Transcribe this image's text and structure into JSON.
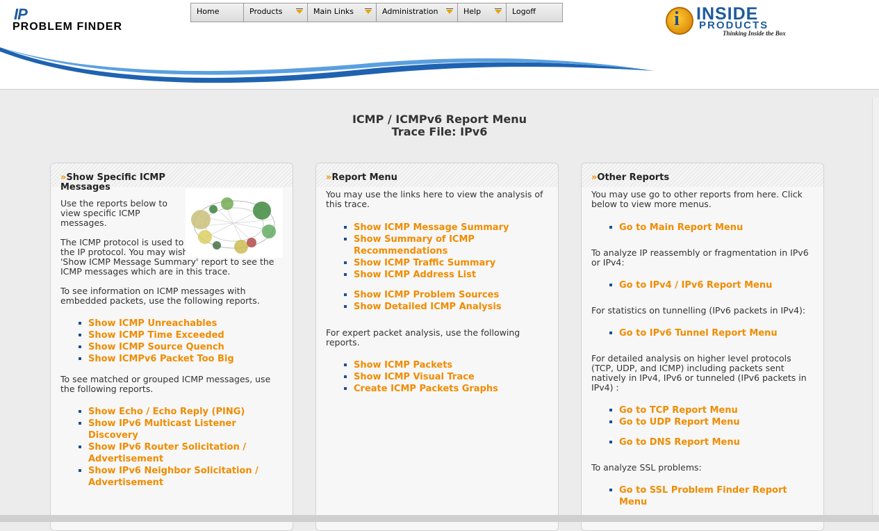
{
  "logo": {
    "ip": "IP",
    "name": "PROBLEM FINDER"
  },
  "nav": [
    {
      "label": "Home",
      "dropdown": false
    },
    {
      "label": "Products",
      "dropdown": true
    },
    {
      "label": "Main Links",
      "dropdown": true
    },
    {
      "label": "Administration",
      "dropdown": true
    },
    {
      "label": "Help",
      "dropdown": true
    },
    {
      "label": "Logoff",
      "dropdown": false
    }
  ],
  "brand": {
    "inside": "INSIDE",
    "products": "PRODUCTS",
    "tagline": "Thinking Inside the Box"
  },
  "title": {
    "line1": "ICMP / ICMPv6 Report Menu",
    "line2": "Trace File: IPv6"
  },
  "colors": {
    "accent": "#f08c00",
    "brand_blue": "#1d5b9c",
    "background": "#ececec"
  },
  "left": {
    "title": "Show Specific ICMP Messages",
    "intro": "Use the reports below to view specific ICMP messages.",
    "protocol_text": "The ICMP protocol is used to report problems for the IP protocol. You may wish to start with the 'Show ICMP Message Summary' report to see the ICMP messages which are in this trace.",
    "embedded_text": "To see information on ICMP messages with embedded packets, use the following reports.",
    "embedded_links": [
      "Show ICMP Unreachables",
      "Show ICMP Time Exceeded",
      "Show ICMP Source Quench",
      "Show ICMPv6 Packet Too Big"
    ],
    "grouped_text": "To see matched or grouped ICMP messages, use the following reports.",
    "grouped_links": [
      "Show Echo / Echo Reply (PING)",
      "Show IPv6 Multicast Listener Discovery",
      "Show IPv6 Router Solicitation / Advertisement",
      "Show IPv6 Neighbor Solicitation / Advertisement"
    ]
  },
  "middle": {
    "title": "Report Menu",
    "intro": "You may use the links here to view the analysis of this trace.",
    "links_a": [
      "Show ICMP Message Summary",
      "Show Summary of ICMP Recommendations",
      "Show ICMP Traffic Summary",
      "Show ICMP Address List"
    ],
    "links_b": [
      "Show ICMP Problem Sources",
      "Show Detailed ICMP Analysis"
    ],
    "expert_text": "For expert packet analysis, use the following reports.",
    "links_c": [
      "Show ICMP Packets",
      "Show ICMP Visual Trace",
      "Create ICMP Packets Graphs"
    ]
  },
  "right": {
    "title": "Other Reports",
    "intro": "You may use go to other reports from here. Click below to view more menus.",
    "link_main": "Go to Main Report Menu",
    "reassembly_text": "To analyze IP reassembly or fragmentation in IPv6 or IPv4:",
    "link_ipv4ipv6": "Go to IPv4 / IPv6 Report Menu",
    "tunnel_text": "For statistics on tunnelling (IPv6 packets in IPv4):",
    "link_tunnel": "Go to IPv6 Tunnel Report Menu",
    "detail_text": "For detailed analysis on higher level protocols (TCP, UDP, and ICMP) including packets sent natively in IPv4, IPv6 or tunneled (IPv6 packets in IPv4) :",
    "link_tcp": "Go to TCP Report Menu",
    "link_udp": "Go to UDP Report Menu",
    "link_dns": "Go to DNS Report Menu",
    "ssl_text": "To analyze SSL problems:",
    "link_ssl": "Go to SSL Problem Finder Report Menu"
  }
}
